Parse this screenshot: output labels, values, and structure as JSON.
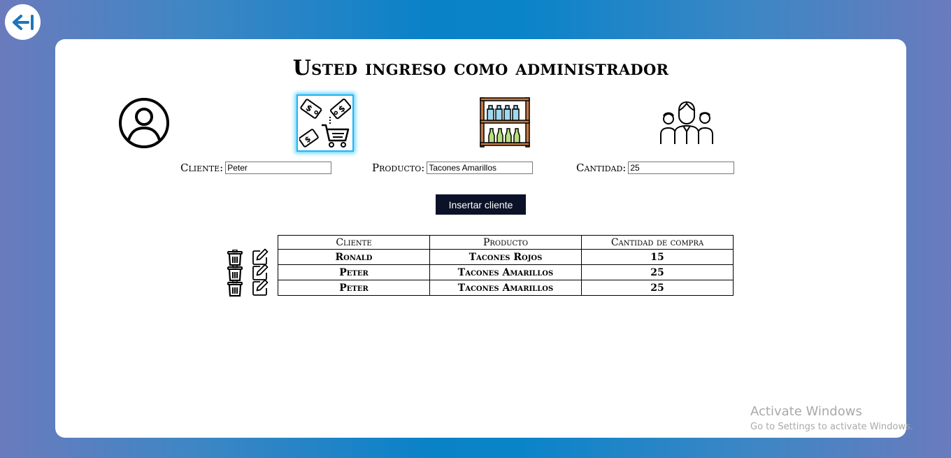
{
  "header": {
    "title": "Usted ingreso como administrador"
  },
  "icons": {
    "back": "back-arrow-icon",
    "client": "user-circle-icon",
    "product": "shopping-cart-price-tags-icon",
    "inventory": "shelf-bottles-icon",
    "clients_group": "people-group-icon",
    "delete": "trash-icon",
    "edit": "pencil-edit-icon"
  },
  "form": {
    "cliente_label": "Cliente:",
    "cliente_value": "Peter",
    "producto_label": "Producto:",
    "producto_value": "Tacones Amarillos",
    "cantidad_label": "Cantidad:",
    "cantidad_value": "25",
    "submit_label": "Insertar cliente"
  },
  "table": {
    "headers": [
      "Cliente",
      "Producto",
      "Cantidad de compra"
    ],
    "rows": [
      [
        "Ronald",
        "Tacones Rojos",
        "15"
      ],
      [
        "Peter",
        "Tacones Amarillos",
        "25"
      ],
      [
        "Peter",
        "Tacones Amarillos",
        "25"
      ]
    ]
  },
  "watermark": {
    "line1": "Activate Windows",
    "line2": "Go to Settings to activate Windows."
  },
  "colors": {
    "background_center": "#0a82c8",
    "background_edge": "#6a7bbd",
    "button_bg": "#0b1228",
    "highlight_border": "#23b5f2",
    "back_arrow": "#1c75bc"
  }
}
